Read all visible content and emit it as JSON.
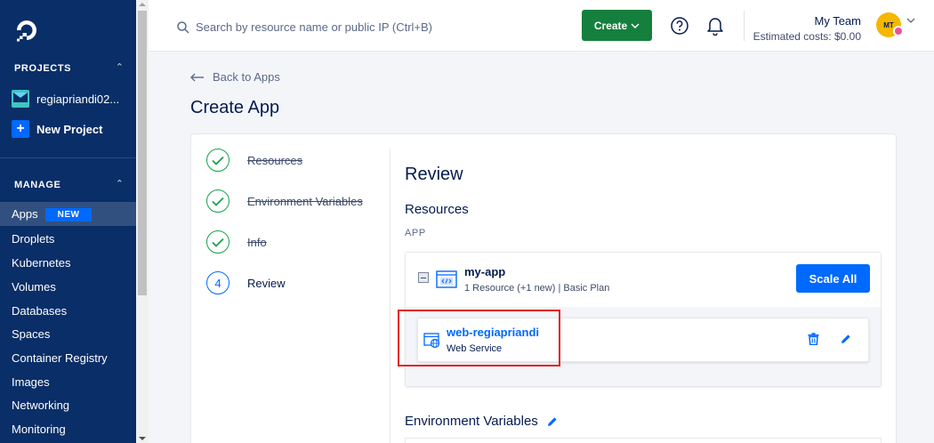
{
  "sidebar": {
    "projects_heading": "PROJECTS",
    "project_name": "regiapriandi02...",
    "new_project_label": "New Project",
    "manage_heading": "MANAGE",
    "nav": [
      {
        "label": "Apps",
        "badge": "NEW",
        "active": true
      },
      {
        "label": "Droplets"
      },
      {
        "label": "Kubernetes"
      },
      {
        "label": "Volumes"
      },
      {
        "label": "Databases"
      },
      {
        "label": "Spaces"
      },
      {
        "label": "Container Registry"
      },
      {
        "label": "Images"
      },
      {
        "label": "Networking"
      },
      {
        "label": "Monitoring"
      }
    ]
  },
  "topbar": {
    "search_placeholder": "Search by resource name or public IP (Ctrl+B)",
    "create_label": "Create",
    "team_name": "My Team",
    "estimated_costs": "Estimated costs: $0.00",
    "avatar_initials": "MT"
  },
  "page": {
    "back_link": "Back to Apps",
    "title": "Create App"
  },
  "steps": [
    {
      "label": "Resources",
      "done": true
    },
    {
      "label": "Environment Variables",
      "done": true
    },
    {
      "label": "Info",
      "done": true
    },
    {
      "label": "Review",
      "number": "4",
      "done": false
    }
  ],
  "review": {
    "title": "Review",
    "resources_heading": "Resources",
    "app_section_label": "APP",
    "app_name": "my-app",
    "app_summary": "1 Resource (+1 new) | Basic Plan",
    "scale_all_label": "Scale All",
    "service_name": "web-regiapriandi",
    "service_type": "Web Service",
    "env_heading": "Environment Variables"
  },
  "colors": {
    "sidebar_bg": "#0a2e67",
    "accent_blue": "#0069ff",
    "create_green": "#15803d",
    "highlight_red": "#e31e24"
  }
}
